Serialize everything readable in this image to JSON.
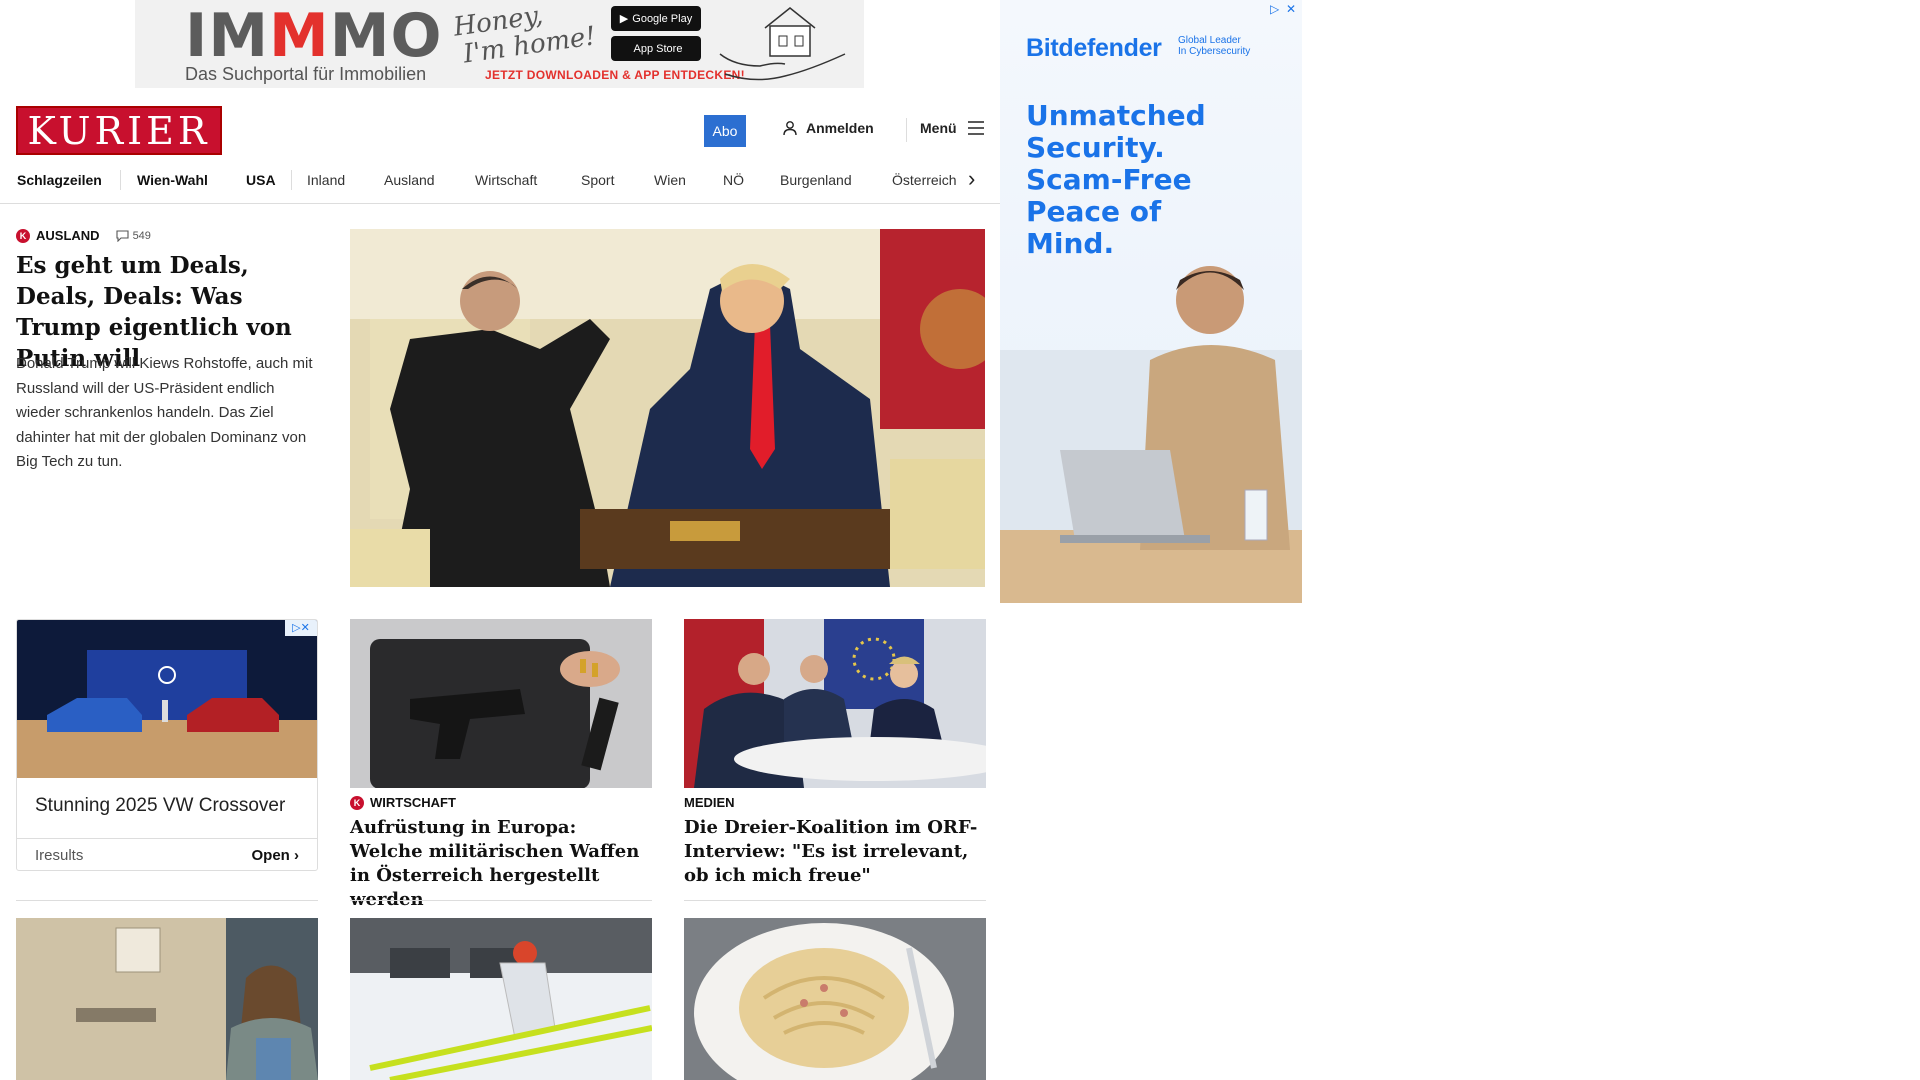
{
  "top_ad": {
    "brand": "IMMMO",
    "subtitle": "Das Suchportal für Immobilien",
    "script_line1": "Honey,",
    "script_line2": "I'm home!",
    "google_play": "Google Play",
    "app_store": "App Store",
    "cta": "JETZT DOWNLOADEN & APP ENTDECKEN!"
  },
  "header": {
    "logo": "KURIER",
    "abo": "Abo",
    "login": "Anmelden",
    "menu": "Menü"
  },
  "nav": {
    "items": [
      "Schlagzeilen",
      "Wien-Wahl",
      "USA",
      "Inland",
      "Ausland",
      "Wirtschaft",
      "Sport",
      "Wien",
      "NÖ",
      "Burgenland",
      "Österreich"
    ]
  },
  "lead": {
    "kategorie": "AUSLAND",
    "comments": "549",
    "title": "Es geht um Deals, Deals, Deals: Was Trump eigentlich von Putin will",
    "text": "Donald Trump will Kiews Rohstoffe, auch mit Russland will der US-Präsident endlich wieder schrankenlos handeln. Das Ziel dahinter hat mit der globalen Dominanz von Big Tech zu tun."
  },
  "side_ad": {
    "brand": "Bitdefender",
    "tag_line1": "Global Leader",
    "tag_line2": "In Cybersecurity",
    "headline_lines": [
      "Unmatched",
      "Security.",
      "Scam-Free",
      "Peace of",
      "Mind."
    ]
  },
  "vw_ad": {
    "title": "Stunning 2025 VW Crossover",
    "source": "Iresults",
    "open": "Open"
  },
  "cards": [
    {
      "kategorie": "WIRTSCHAFT",
      "title": "Aufrüstung in Europa: Welche militärischen Waffen in Österreich hergestellt werden"
    },
    {
      "kategorie": "MEDIEN",
      "title": "Die Dreier-Koalition im ORF-Interview: \"Es ist irrelevant, ob ich mich freue\""
    }
  ],
  "colors": {
    "kurier_red": "#c8102e",
    "abo_blue": "#2c6fd1",
    "bitdefender_blue": "#1a73e8"
  }
}
